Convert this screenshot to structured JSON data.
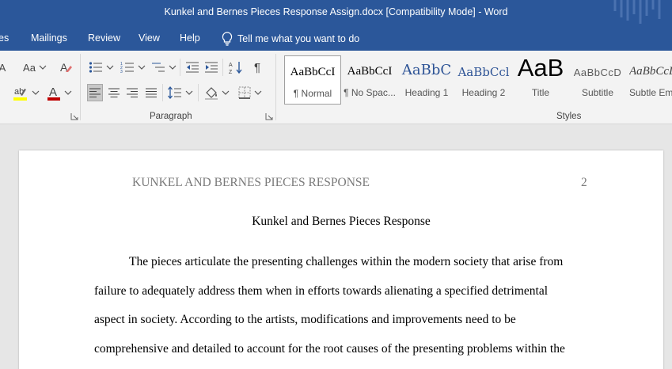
{
  "window": {
    "title": "Kunkel and Bernes Pieces Response Assign.docx [Compatibility Mode]  -  Word"
  },
  "menu": {
    "tabs": [
      "es",
      "Mailings",
      "Review",
      "View",
      "Help"
    ],
    "tell_me": "Tell me what you want to do"
  },
  "ribbon": {
    "font_aa": "Aa",
    "paragraph_label": "Paragraph",
    "styles_label": "Styles",
    "highlight_color": "#ffff00",
    "font_color": "#c00000",
    "styles": [
      {
        "preview": "AaBbCcI",
        "name": "¶ Normal"
      },
      {
        "preview": "AaBbCcI",
        "name": "¶ No Spac..."
      },
      {
        "preview": "AaBbC",
        "name": "Heading 1"
      },
      {
        "preview": "AaBbCcl",
        "name": "Heading 2"
      },
      {
        "preview": "AaB",
        "name": "Title"
      },
      {
        "preview": "AaBbCcD",
        "name": "Subtitle"
      },
      {
        "preview": "AaBbCcL",
        "name": "Subtle Em"
      }
    ]
  },
  "document": {
    "header_text": "KUNKEL AND BERNES PIECES RESPONSE",
    "page_number": "2",
    "title": "Kunkel and Bernes Pieces Response",
    "lines": [
      "The pieces articulate the presenting challenges within the modern society that arise from",
      "failure to adequately address them when in efforts towards alienating a specified detrimental",
      "aspect in society. According to the artists, modifications and improvements need to be",
      "comprehensive and detailed to account for the root causes of the presenting problems within the"
    ]
  }
}
